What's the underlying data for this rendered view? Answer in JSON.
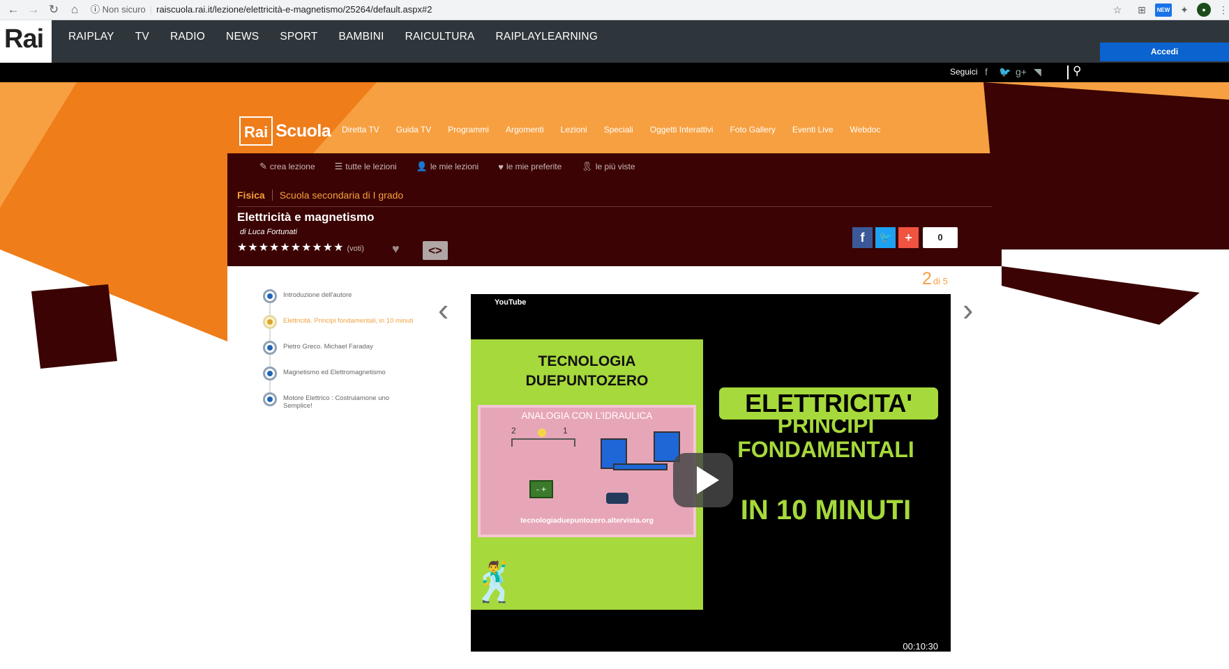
{
  "browser": {
    "insecure_label": "Non sicuro",
    "url": "raiscuola.rai.it/lezione/elettricità-e-magnetismo/25264/default.aspx#2",
    "ext_new_label": "NEW"
  },
  "rai": {
    "logo": "Rai",
    "menu": [
      "RAIPLAY",
      "TV",
      "RADIO",
      "NEWS",
      "SPORT",
      "BAMBINI",
      "RAICULTURA",
      "RAIPLAYLEARNING"
    ],
    "login_label": "Accedi",
    "follow_label": "Seguici"
  },
  "scuola": {
    "logo_rai": "Rai",
    "logo_text": "Scuola",
    "menu": [
      "Diretta TV",
      "Guida TV",
      "Programmi",
      "Argomenti",
      "Lezioni",
      "Speciali",
      "Oggetti Interattivi",
      "Foto Gallery",
      "Eventi Live",
      "Webdoc"
    ],
    "tools": [
      "crea lezione",
      "tutte le lezioni",
      "le mie lezioni",
      "le mie preferite",
      "le più viste"
    ]
  },
  "lesson": {
    "subject": "Fisica",
    "grade": "Scuola secondaria di I grado",
    "title": "Elettricità e magnetismo",
    "author": "di Luca Fortunati",
    "stars": "★★★★★★★★★★",
    "votes_label": "(voti)",
    "embed_label": "<>",
    "share_count": "0",
    "counter_current": "2",
    "counter_total": "di 5"
  },
  "playlist": [
    {
      "label": "Introduzione dell'autore",
      "active": false
    },
    {
      "label": "Elettricità. Principi fondamentali, in 10 minuti",
      "active": true
    },
    {
      "label": "Pietro Greco. Michael Faraday",
      "active": false
    },
    {
      "label": "Magnetismo ed Elettromagnetismo",
      "active": false
    },
    {
      "label": "Motore Elettrico : Costruiamone uno Semplice!",
      "active": false
    }
  ],
  "video": {
    "provider": "YouTube",
    "thumb_title_1": "TECNOLOGIA",
    "thumb_title_2": "DUEPUNTOZERO",
    "analogy": "ANALOGIA CON L'IDRAULICA",
    "site": "tecnologiaduepuntozero.altervista.org",
    "badge": "ELETTRICITA'",
    "line1": "PRINCIPI",
    "line2": "FONDAMENTALI",
    "line3": "IN 10 MINUTI",
    "duration": "00:10:30"
  },
  "colors": {
    "orange": "#f7a041",
    "maroon": "#3b0303",
    "rai_nav": "#2f363b",
    "accedi_blue": "#0a63cf",
    "thumb_green": "#a6d93b"
  }
}
